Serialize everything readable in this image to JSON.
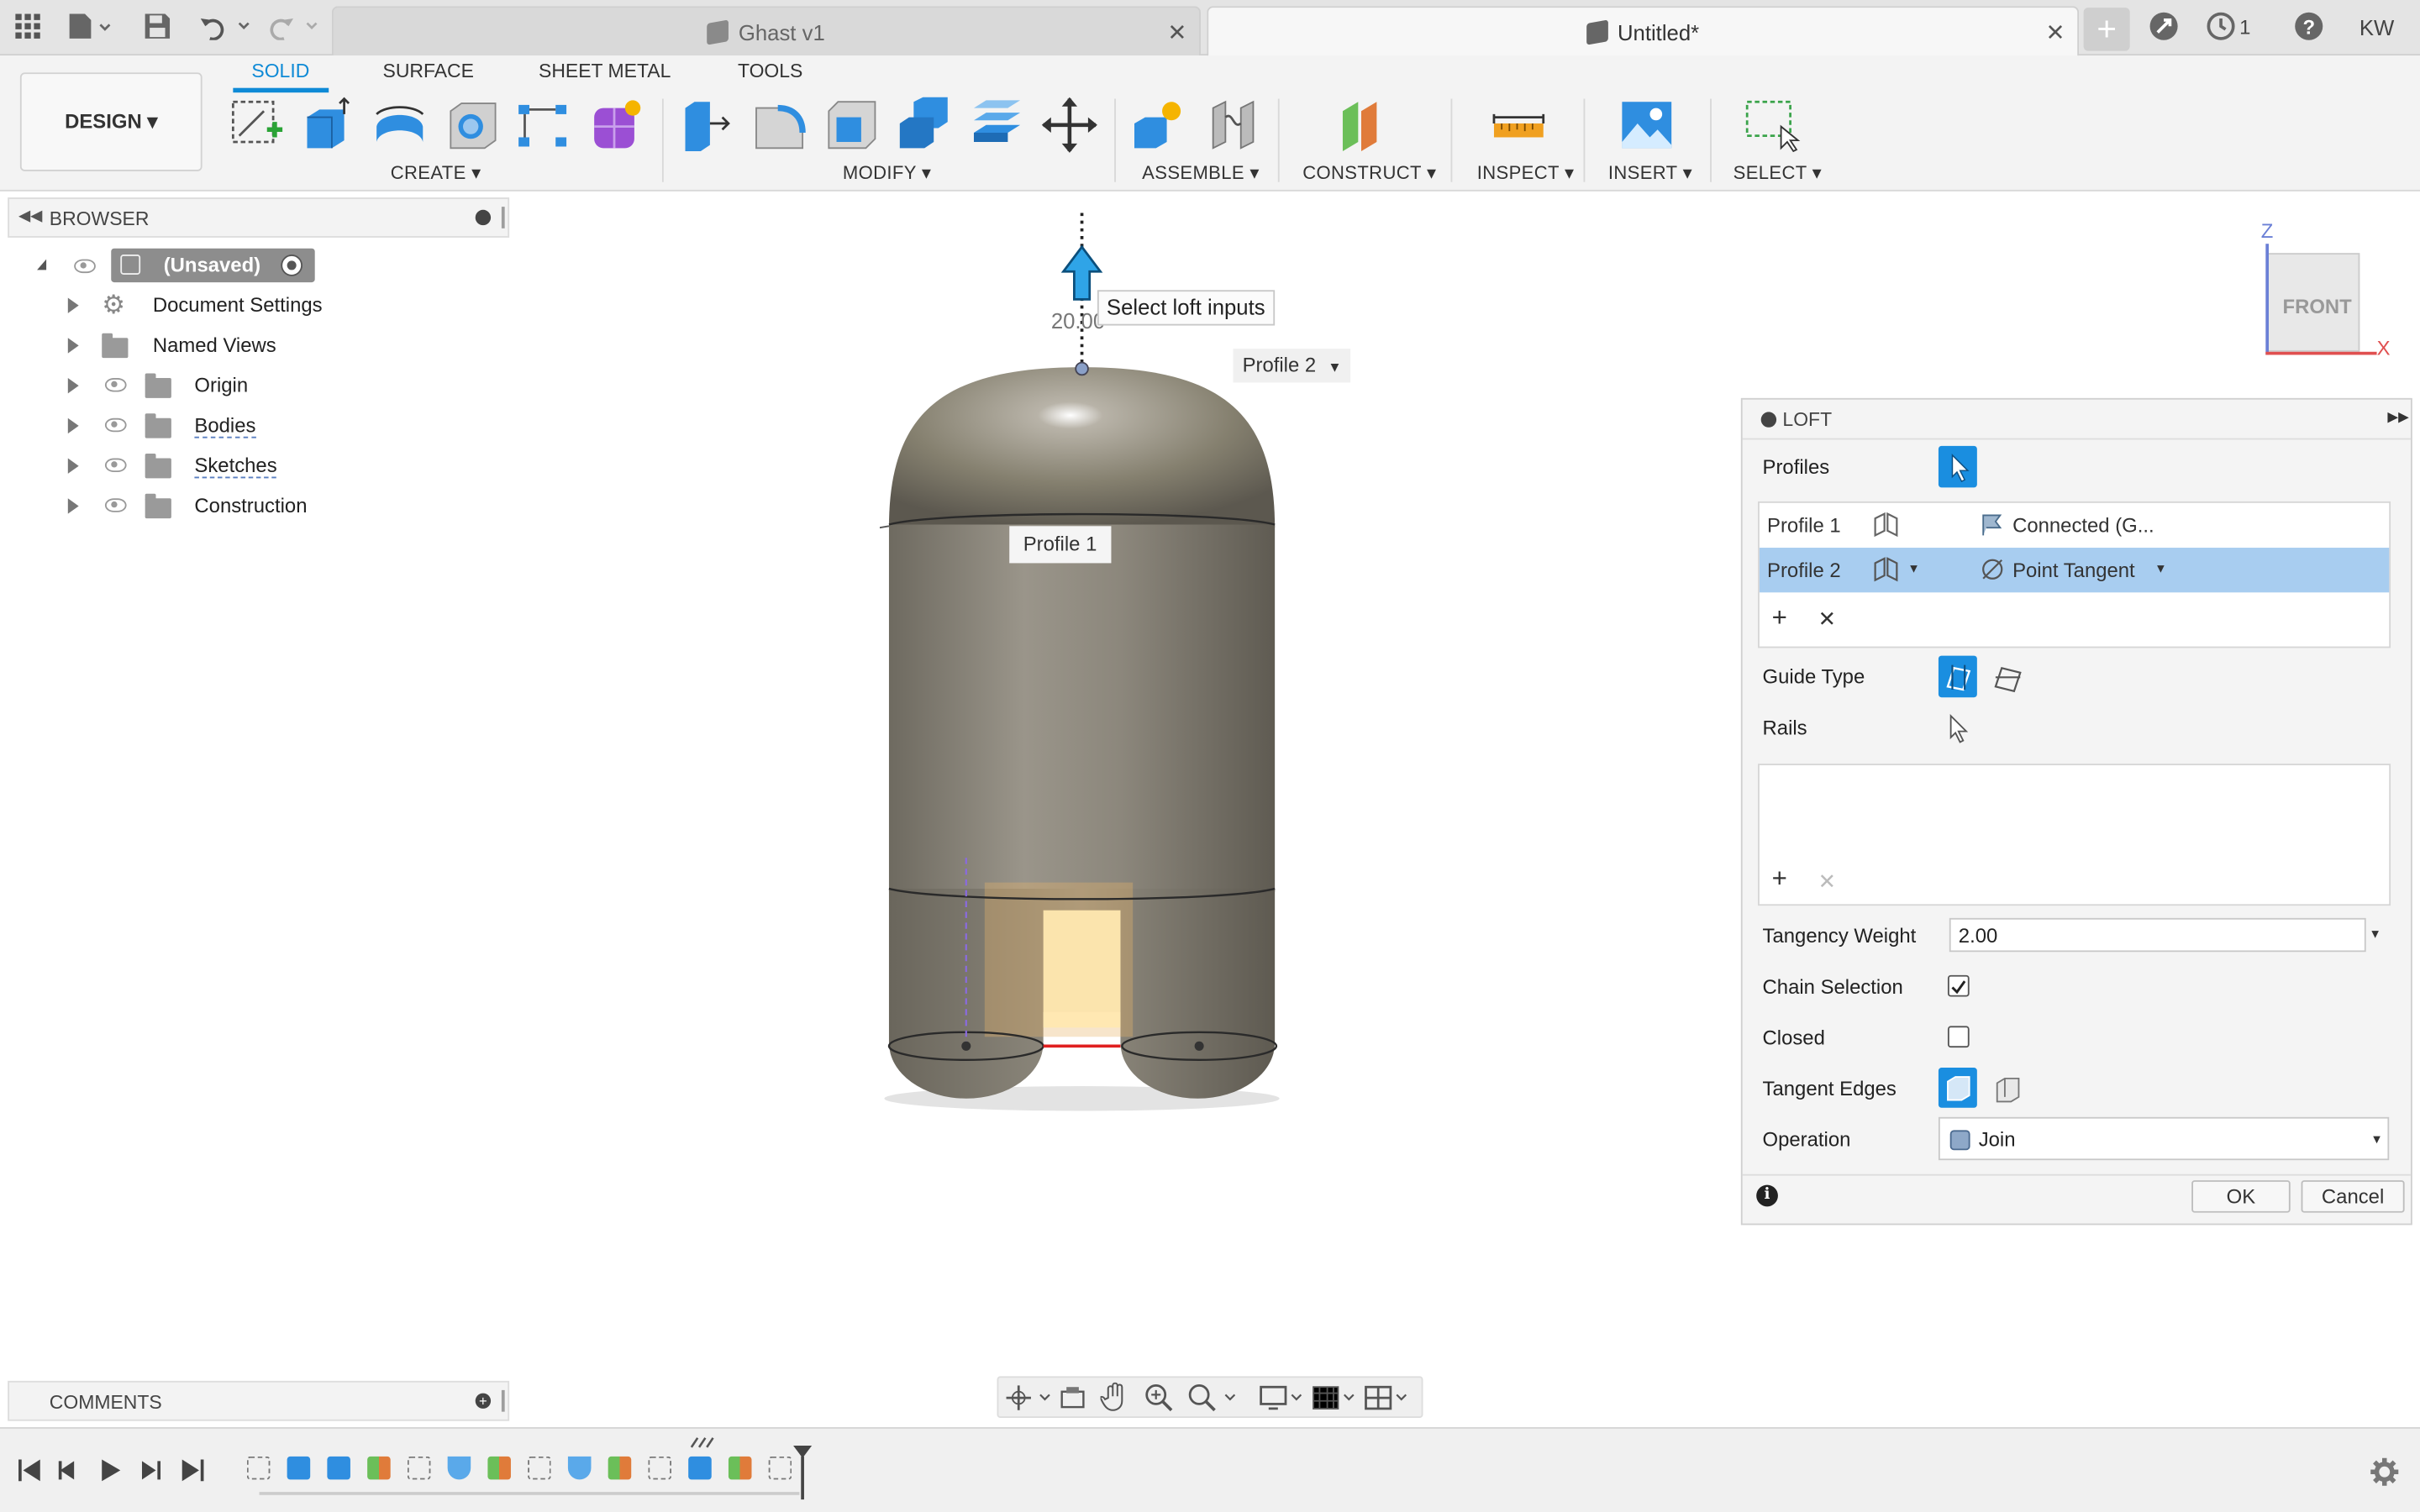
{
  "tabs": [
    {
      "title": "Ghast v1",
      "active": false
    },
    {
      "title": "Untitled*",
      "active": true
    }
  ],
  "top_right": {
    "jobs_count": "1",
    "user_initials": "KW"
  },
  "workspace": {
    "label": "DESIGN ▾"
  },
  "ribbon": {
    "tabs": [
      "SOLID",
      "SURFACE",
      "SHEET METAL",
      "TOOLS"
    ],
    "active_tab": "SOLID",
    "groups": [
      "CREATE ▾",
      "MODIFY ▾",
      "ASSEMBLE ▾",
      "CONSTRUCT ▾",
      "INSPECT ▾",
      "INSERT ▾",
      "SELECT ▾"
    ]
  },
  "browser": {
    "title": "BROWSER",
    "root": "(Unsaved)",
    "items": [
      "Document Settings",
      "Named Views",
      "Origin",
      "Bodies",
      "Sketches",
      "Construction"
    ]
  },
  "viewport": {
    "tooltip": "Select loft inputs",
    "dimension": "20.00",
    "profile1_label": "Profile 1",
    "profile2_label": "Profile 2",
    "viewcube_face": "FRONT",
    "axis_z": "Z",
    "axis_x": "X"
  },
  "loft": {
    "title": "LOFT",
    "profiles_label": "Profiles",
    "profiles": [
      {
        "name": "Profile 1",
        "condition": "Connected (G...",
        "selected": false
      },
      {
        "name": "Profile 2",
        "condition": "Point Tangent",
        "selected": true
      }
    ],
    "guide_type_label": "Guide Type",
    "rails_label": "Rails",
    "tangency_weight_label": "Tangency Weight",
    "tangency_weight_value": "2.00",
    "chain_selection_label": "Chain Selection",
    "chain_selection_checked": true,
    "closed_label": "Closed",
    "closed_checked": false,
    "tangent_edges_label": "Tangent Edges",
    "operation_label": "Operation",
    "operation_value": "Join",
    "ok_label": "OK",
    "cancel_label": "Cancel"
  },
  "comments": {
    "title": "COMMENTS"
  },
  "colors": {
    "accent": "#0e8ad6",
    "selected_row": "#a8cdf0",
    "body": "#8a8578"
  }
}
